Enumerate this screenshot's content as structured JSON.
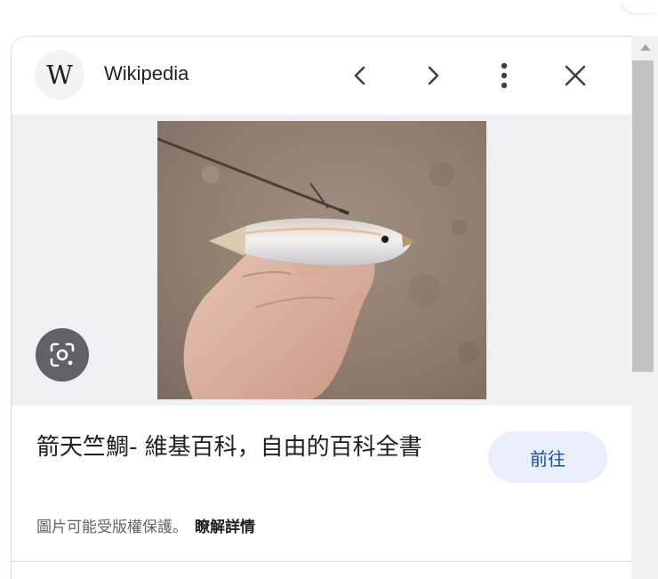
{
  "header": {
    "source_name": "Wikipedia",
    "logo_letter": "W",
    "icons": [
      "wikipedia-logo",
      "chevron-left-icon",
      "chevron-right-icon",
      "more-vert-icon",
      "close-icon"
    ]
  },
  "image": {
    "lens_icon": "google-lens-icon"
  },
  "result": {
    "title": "箭天竺鯛- 維基百科，自由的百科全書",
    "go_button_label": "前往",
    "copyright_notice": "圖片可能受版權保護。",
    "learn_more_label": "瞭解詳情"
  },
  "colors": {
    "accent_button_bg": "#e8effa",
    "accent_button_text": "#1a4f9c",
    "image_bg": "#eef0f2"
  }
}
